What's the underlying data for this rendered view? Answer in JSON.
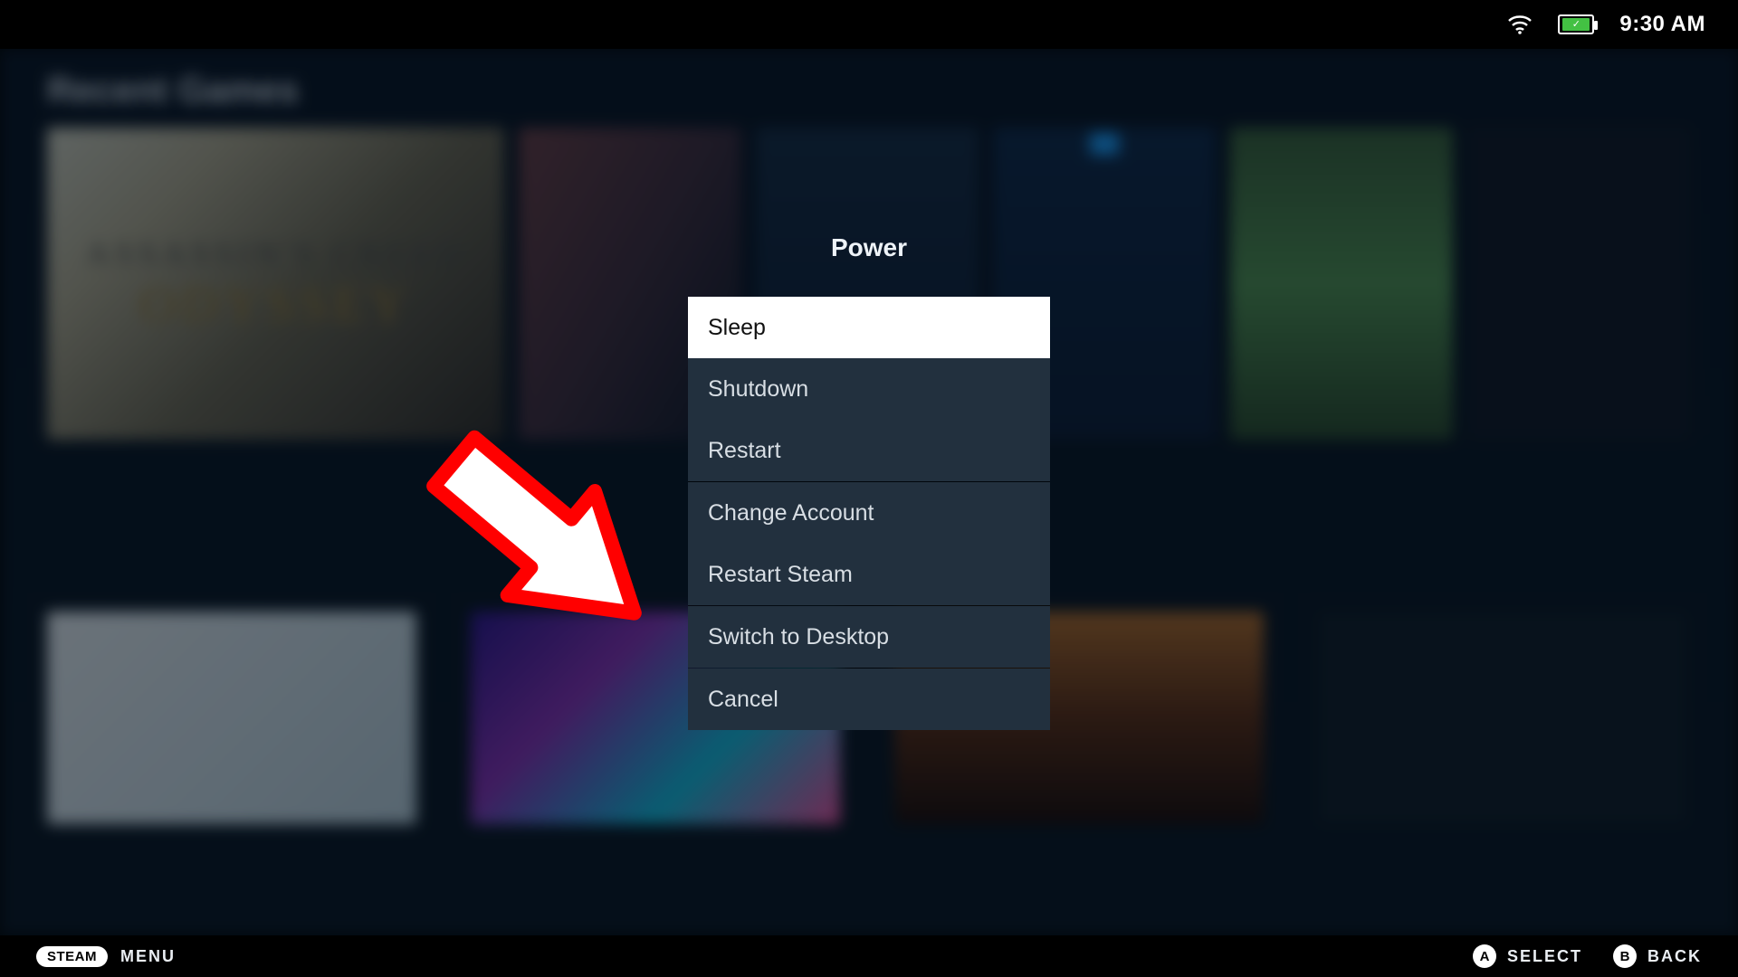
{
  "status": {
    "time": "9:30 AM"
  },
  "library": {
    "section_title": "Recent Games",
    "featured_title_upper": "ASSASSIN'S CREED",
    "featured_title_lower": "ODYSSEY"
  },
  "dialog": {
    "title": "Power",
    "items": [
      {
        "label": "Sleep",
        "selected": true
      },
      {
        "label": "Shutdown",
        "selected": false
      },
      {
        "label": "Restart",
        "selected": false
      },
      {
        "label": "Change Account",
        "selected": false
      },
      {
        "label": "Restart Steam",
        "selected": false
      },
      {
        "label": "Switch to Desktop",
        "selected": false
      },
      {
        "label": "Cancel",
        "selected": false
      }
    ],
    "separators_after": [
      2,
      4,
      5
    ]
  },
  "bottom": {
    "steam_pill": "STEAM",
    "menu_label": "MENU",
    "hints": [
      {
        "button": "A",
        "label": "SELECT"
      },
      {
        "button": "B",
        "label": "BACK"
      }
    ]
  }
}
